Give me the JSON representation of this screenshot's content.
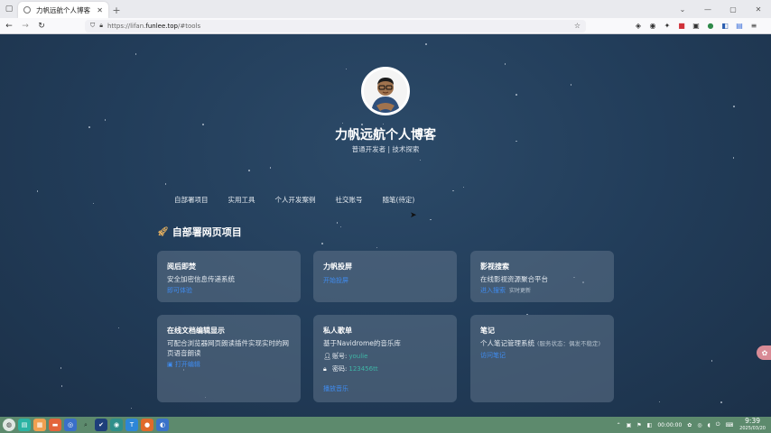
{
  "browser": {
    "tab_title": "力帆远航个人博客",
    "url_prefix": "https://lifan.",
    "url_domain": "funlee.top",
    "url_suffix": "/#tools"
  },
  "site": {
    "title": "力帆远航个人博客",
    "subtitle": "普通开发者 | 技术探索"
  },
  "menu": [
    "自部署项目",
    "实用工具",
    "个人开发案例",
    "社交账号",
    "随笔(待定)"
  ],
  "section": {
    "title": "自部署网页项目"
  },
  "cards": [
    {
      "title": "阅后即焚",
      "desc": "安全加密信息传递系统",
      "link": "即可体验"
    },
    {
      "title": "力帆投屏",
      "desc": "",
      "link": "开始投屏"
    },
    {
      "title": "影视搜索",
      "desc": "在线影视资源聚合平台",
      "link": "进入搜索",
      "note": "实时更新"
    },
    {
      "title": "在线文档编辑显示",
      "desc": "可配合浏览器网页朗读插件实现实时的网页语音朗读",
      "link": "打开编辑"
    },
    {
      "title": "私人歌单",
      "desc": "基于Navidrome的音乐库",
      "account_label": "账号:",
      "account_value": "youlie",
      "password_label": "密码:",
      "password_value": "123456tt",
      "link": "播放音乐"
    },
    {
      "title": "笔记",
      "desc": "个人笔记管理系统",
      "status": "(服务状态：偶发不稳定)",
      "link": "访问笔记"
    }
  ],
  "taskbar": {
    "tray_time_counter": "00:00:00",
    "clock_time": "9:39",
    "clock_date": "2025/03/20"
  },
  "colors": {
    "page_bg": "#223d5a",
    "card_bg": "#5f7389",
    "link": "#3f8cf0",
    "taskbar": "#5d8a6d"
  }
}
